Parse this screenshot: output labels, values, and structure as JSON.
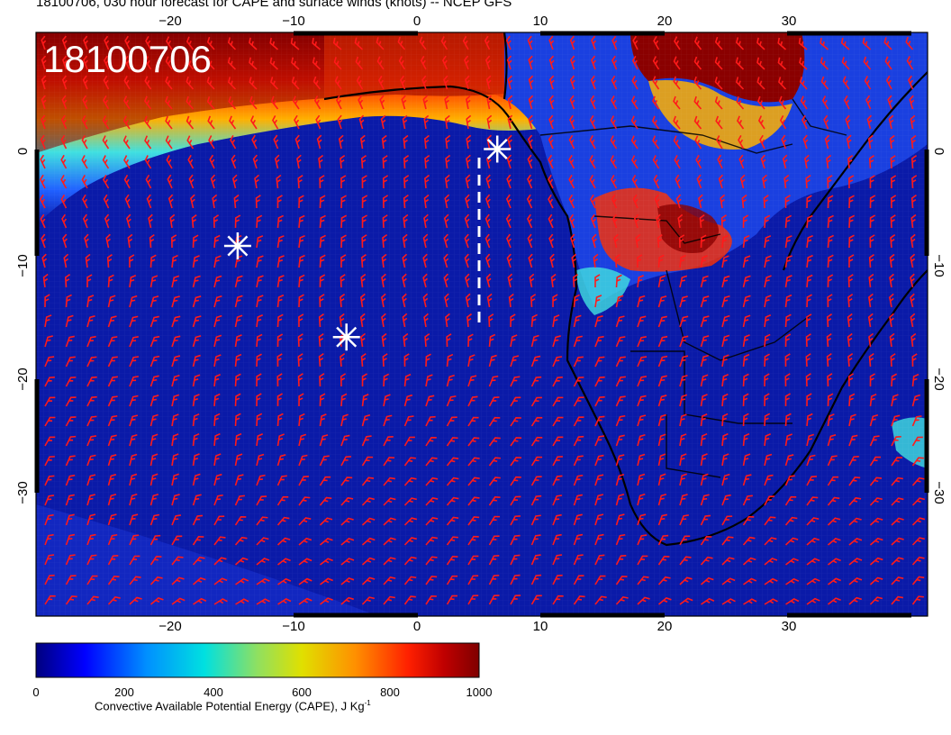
{
  "title": "18100706, 030 hour forecast for CAPE and surface winds (knots) -- NCEP GFS",
  "stamp": "18100706",
  "map": {
    "lon_ticks": [
      "−20",
      "−10",
      "0",
      "10",
      "20",
      "30"
    ],
    "lat_ticks": [
      "0",
      "−10",
      "−20",
      "−30"
    ]
  },
  "colorbar": {
    "tick_labels": [
      "0",
      "200",
      "400",
      "600",
      "800",
      "1000"
    ],
    "label": "Convective Available Potential Energy (CAPE), J Kg",
    "label_sup": "-1",
    "min": 0,
    "max": 1000,
    "colors": [
      "#00007f",
      "#0000ff",
      "#0090ff",
      "#00e0e0",
      "#90e060",
      "#e0e000",
      "#ff9000",
      "#ff2000",
      "#c00000",
      "#7f0000"
    ]
  },
  "markers": [
    {
      "lon": 6.5,
      "lat": 0.2
    },
    {
      "lon": -14.5,
      "lat": -8.3
    },
    {
      "lon": -5.7,
      "lat": -16.3
    }
  ],
  "colors": {
    "ocean": "#0a1aa8",
    "barbs": "#ff1a1a",
    "coast": "#000000",
    "marker": "#ffffff"
  }
}
